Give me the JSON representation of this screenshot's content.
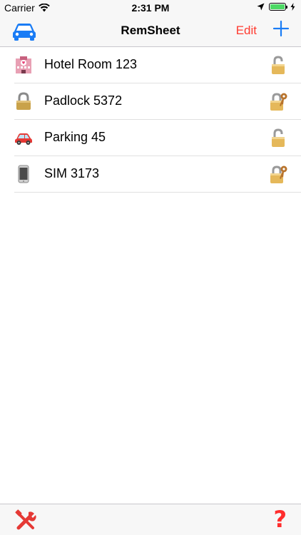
{
  "status_bar": {
    "carrier": "Carrier",
    "time": "2:31 PM"
  },
  "nav": {
    "title": "RemSheet",
    "edit_label": "Edit",
    "left_icon": "car-icon",
    "add_icon": "plus-icon"
  },
  "items": [
    {
      "label": "Hotel Room 123",
      "icon": "hotel-icon",
      "lock": "open-lock-icon"
    },
    {
      "label": "Padlock 5372",
      "icon": "padlock-icon",
      "lock": "locked-with-key-icon"
    },
    {
      "label": "Parking 45",
      "icon": "car-icon",
      "lock": "open-lock-icon"
    },
    {
      "label": "SIM 3173",
      "icon": "phone-icon",
      "lock": "locked-with-key-icon"
    }
  ],
  "toolbar": {
    "left_icon": "tools-icon",
    "help_label": "?"
  },
  "colors": {
    "accent_blue": "#1a7cf5",
    "accent_red": "#ff3b30"
  }
}
